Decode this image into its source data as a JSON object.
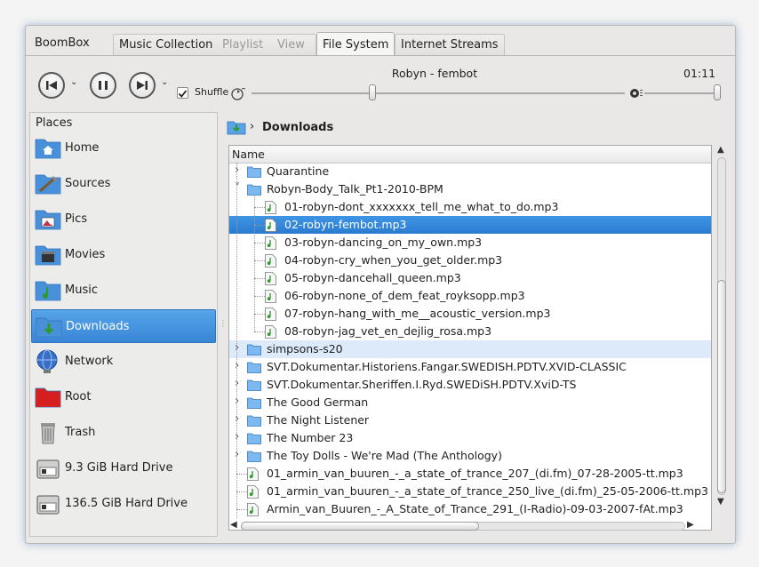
{
  "app_name": "BoomBox",
  "tabs": [
    {
      "label": "Music Collection",
      "state": "inactive"
    },
    {
      "label": "Playlist",
      "state": "disabled"
    },
    {
      "label": "View",
      "state": "disabled"
    },
    {
      "label": "File System",
      "state": "active"
    },
    {
      "label": "Internet Streams",
      "state": "inactive"
    }
  ],
  "player": {
    "now_playing": "Robyn - fembot",
    "time": "01:11",
    "shuffle_label": "Shuffle",
    "shuffle_checked": true,
    "progress_fraction": 0.3,
    "volume_fraction": 1.0
  },
  "places": {
    "title": "Places",
    "items": [
      {
        "label": "Home",
        "icon": "home-folder-icon",
        "color": "#4a90d9"
      },
      {
        "label": "Sources",
        "icon": "tools-folder-icon",
        "color": "#4a90d9"
      },
      {
        "label": "Pics",
        "icon": "pictures-folder-icon",
        "color": "#4a90d9"
      },
      {
        "label": "Movies",
        "icon": "movies-folder-icon",
        "color": "#4a90d9"
      },
      {
        "label": "Music",
        "icon": "music-folder-icon",
        "color": "#4a90d9"
      },
      {
        "label": "Downloads",
        "icon": "downloads-folder-icon",
        "color": "#4a90d9",
        "selected": true
      },
      {
        "label": "Network",
        "icon": "network-globe-icon",
        "color": "#3a6fc8"
      },
      {
        "label": "Root",
        "icon": "root-folder-icon",
        "color": "#d62020"
      },
      {
        "label": "Trash",
        "icon": "trash-icon",
        "color": "#888888"
      },
      {
        "label": "9.3 GiB Hard Drive",
        "icon": "hard-drive-icon",
        "color": "#888888"
      },
      {
        "label": "136.5 GiB Hard Drive",
        "icon": "hard-drive-icon",
        "color": "#888888"
      }
    ]
  },
  "breadcrumb": {
    "current": "Downloads"
  },
  "tree": {
    "header": "Name",
    "rows": [
      {
        "label": "Quarantine",
        "type": "folder",
        "depth": 0,
        "expanded": false
      },
      {
        "label": "Robyn-Body_Talk_Pt1-2010-BPM",
        "type": "folder",
        "depth": 0,
        "expanded": true
      },
      {
        "label": "01-robyn-dont_xxxxxxx_tell_me_what_to_do.mp3",
        "type": "audio",
        "depth": 1
      },
      {
        "label": "02-robyn-fembot.mp3",
        "type": "audio",
        "depth": 1,
        "selected": true
      },
      {
        "label": "03-robyn-dancing_on_my_own.mp3",
        "type": "audio",
        "depth": 1
      },
      {
        "label": "04-robyn-cry_when_you_get_older.mp3",
        "type": "audio",
        "depth": 1
      },
      {
        "label": "05-robyn-dancehall_queen.mp3",
        "type": "audio",
        "depth": 1
      },
      {
        "label": "06-robyn-none_of_dem_feat_royksopp.mp3",
        "type": "audio",
        "depth": 1
      },
      {
        "label": "07-robyn-hang_with_me__acoustic_version.mp3",
        "type": "audio",
        "depth": 1
      },
      {
        "label": "08-robyn-jag_vet_en_dejlig_rosa.mp3",
        "type": "audio",
        "depth": 1
      },
      {
        "label": "simpsons-s20",
        "type": "folder",
        "depth": 0,
        "expanded": false,
        "hover": true
      },
      {
        "label": "SVT.Dokumentar.Historiens.Fangar.SWEDISH.PDTV.XVID-CLASSIC",
        "type": "folder",
        "depth": 0,
        "expanded": false
      },
      {
        "label": "SVT.Dokumentar.Sheriffen.I.Ryd.SWEDiSH.PDTV.XviD-TS",
        "type": "folder",
        "depth": 0,
        "expanded": false
      },
      {
        "label": "The Good German",
        "type": "folder",
        "depth": 0,
        "expanded": false
      },
      {
        "label": "The Night Listener",
        "type": "folder",
        "depth": 0,
        "expanded": false
      },
      {
        "label": "The Number 23",
        "type": "folder",
        "depth": 0,
        "expanded": false
      },
      {
        "label": "The Toy Dolls - We're Mad (The Anthology)",
        "type": "folder",
        "depth": 0,
        "expanded": false
      },
      {
        "label": "01_armin_van_buuren_-_a_state_of_trance_207_(di.fm)_07-28-2005-tt.mp3",
        "type": "audio",
        "depth": 0
      },
      {
        "label": "01_armin_van_buuren_-_a_state_of_trance_250_live_(di.fm)_25-05-2006-tt.mp3",
        "type": "audio",
        "depth": 0
      },
      {
        "label": "Armin_van_Buuren_-_A_State_of_Trance_291_(I-Radio)-09-03-2007-fAt.mp3",
        "type": "audio",
        "depth": 0
      }
    ]
  },
  "colors": {
    "accent": "#3a86d6",
    "folder": "#6aaeea"
  }
}
